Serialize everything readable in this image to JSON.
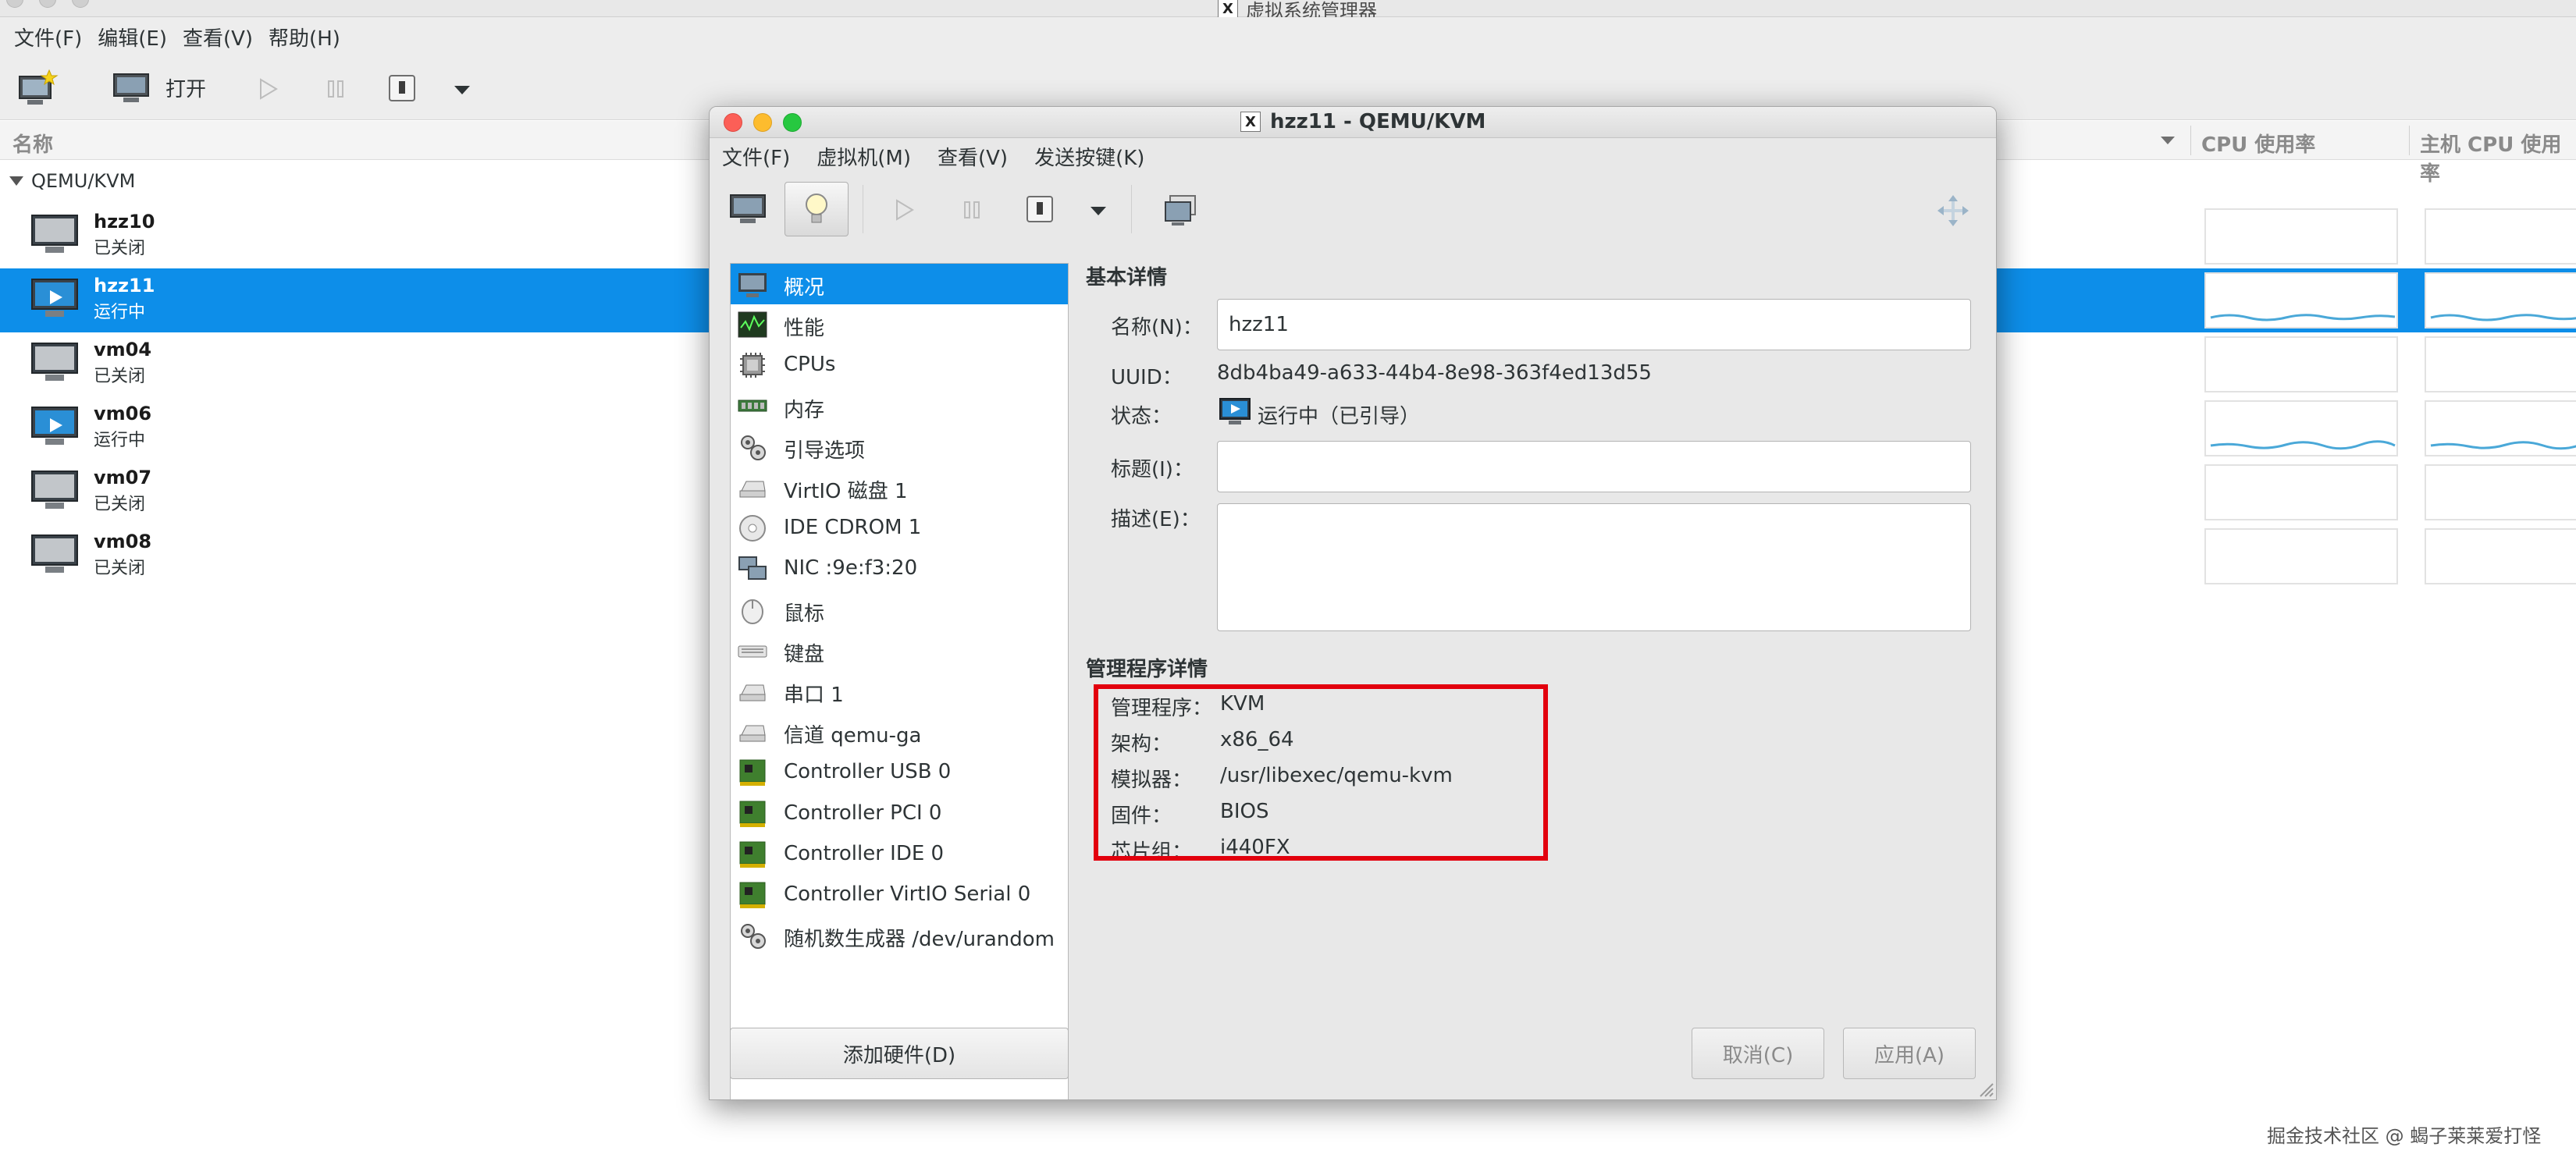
{
  "manager": {
    "window_title": "虚拟系统管理器",
    "menu": [
      "文件(F)",
      "编辑(E)",
      "查看(V)",
      "帮助(H)"
    ],
    "toolbar": {
      "open_label": "打开"
    },
    "columns": {
      "name": "名称",
      "cpu_usage": "CPU 使用率",
      "host_cpu_usage": "主机 CPU 使用率"
    },
    "group": "QEMU/KVM",
    "vms": [
      {
        "name": "hzz10",
        "status": "已关闭",
        "running": false,
        "selected": false
      },
      {
        "name": "hzz11",
        "status": "运行中",
        "running": true,
        "selected": true
      },
      {
        "name": "vm04",
        "status": "已关闭",
        "running": false,
        "selected": false
      },
      {
        "name": "vm06",
        "status": "运行中",
        "running": true,
        "selected": false
      },
      {
        "name": "vm07",
        "status": "已关闭",
        "running": false,
        "selected": false
      },
      {
        "name": "vm08",
        "status": "已关闭",
        "running": false,
        "selected": false
      }
    ]
  },
  "dialog": {
    "title": "hzz11 - QEMU/KVM",
    "menu": [
      "文件(F)",
      "虚拟机(M)",
      "查看(V)",
      "发送按键(K)"
    ],
    "hardware": [
      "概况",
      "性能",
      "CPUs",
      "内存",
      "引导选项",
      "VirtIO 磁盘 1",
      "IDE CDROM 1",
      "NIC :9e:f3:20",
      "鼠标",
      "键盘",
      "串口 1",
      "信道 qemu-ga",
      "Controller USB 0",
      "Controller PCI 0",
      "Controller IDE 0",
      "Controller VirtIO Serial 0",
      "随机数生成器 /dev/urandom"
    ],
    "add_hardware": "添加硬件(D)",
    "basic": {
      "section": "基本详情",
      "name_label": "名称(N)：",
      "name_value": "hzz11",
      "uuid_label": "UUID：",
      "uuid_value": "8db4ba49-a633-44b4-8e98-363f4ed13d55",
      "status_label": "状态：",
      "status_value": "运行中（已引导）",
      "title_label": "标题(I)：",
      "title_value": "",
      "desc_label": "描述(E)："
    },
    "hypervisor": {
      "section": "管理程序详情",
      "rows": [
        {
          "label": "管理程序：",
          "value": "KVM"
        },
        {
          "label": "架构：",
          "value": "x86_64"
        },
        {
          "label": "模拟器：",
          "value": "/usr/libexec/qemu-kvm"
        },
        {
          "label": "固件：",
          "value": "BIOS"
        },
        {
          "label": "芯片组：",
          "value": "i440FX"
        }
      ]
    },
    "cancel": "取消(C)",
    "apply": "应用(A)"
  },
  "watermark": "掘金技术社区 @ 蝎子莱莱爱打怪",
  "colors": {
    "selection": "#0d8ee9",
    "highlight_box": "#e2000d",
    "graph_line": "#4aa8d8"
  }
}
